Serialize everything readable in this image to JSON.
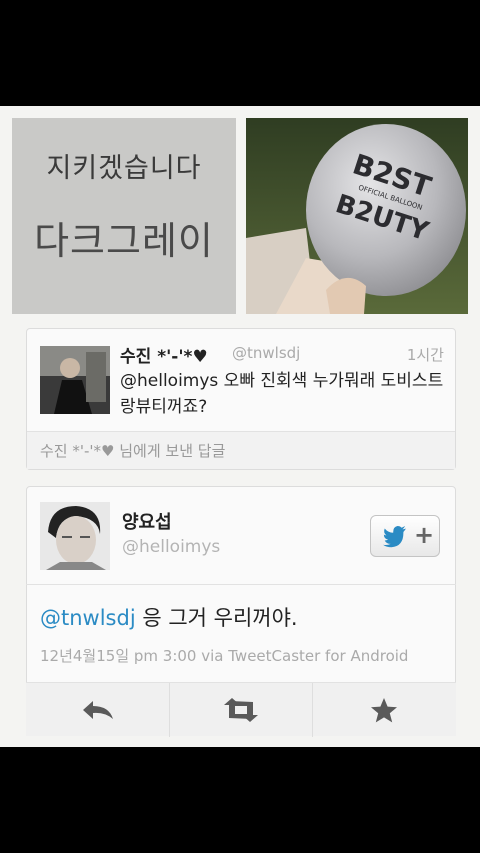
{
  "top_left_image": {
    "line1": "지키겠습니다",
    "line2": "다크그레이"
  },
  "top_right_image": {
    "balloon_line1": "B2ST",
    "balloon_line2": "B2UTY",
    "balloon_small": "OFFICIAL BALLOON"
  },
  "tweet1": {
    "name": "수진 *'-'*♥",
    "handle": "@tnwlsdj",
    "time": "1시간",
    "text": "@helloimys 오빠 진회색 누가뭐래 도비스트랑뷰티꺼죠?",
    "reply_note": "수진 *'-'*♥ 님에게 보낸 답글"
  },
  "tweet2": {
    "name": "양요섭",
    "handle": "@helloimys",
    "mention": "@tnwlsdj",
    "text": " 응 그거 우리꺼야.",
    "meta": "12년4월15일 pm 3:00 via TweetCaster for Android",
    "follow_plus": "+"
  },
  "colors": {
    "mention": "#2b8bc4",
    "background": "#000000",
    "page": "#f4f4f2"
  },
  "icons": [
    "twitter-bird-icon",
    "reply-icon",
    "retweet-icon",
    "favorite-star-icon"
  ]
}
